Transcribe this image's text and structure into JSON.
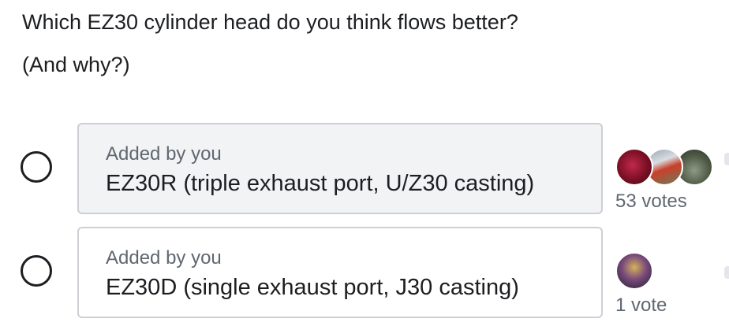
{
  "poll": {
    "question": "Which EZ30 cylinder head do you think flows better?",
    "subquestion": "(And why?)",
    "options": [
      {
        "added_by": "Added by you",
        "text": "EZ30R (triple exhaust port, U/Z30 casting)",
        "votes_label": "53 votes",
        "selected": false
      },
      {
        "added_by": "Added by you",
        "text": "EZ30D (single exhaust port, J30 casting)",
        "votes_label": "1 vote",
        "selected": false
      }
    ]
  },
  "colors": {
    "text": "#1c1e21",
    "secondary_text": "#606770",
    "card_border": "#ccd0d5",
    "card_highlight": "#f2f3f5"
  }
}
